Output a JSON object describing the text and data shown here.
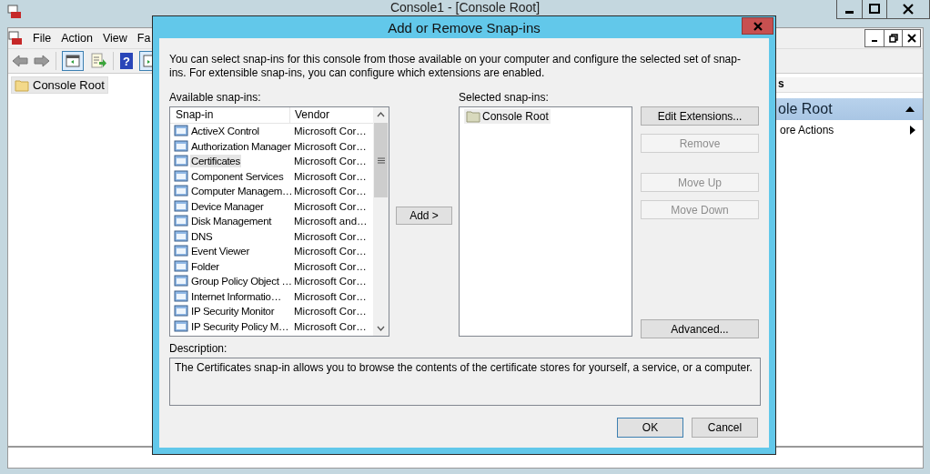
{
  "console": {
    "title": "Console1 - [Console Root]",
    "menu": [
      "File",
      "Action",
      "View",
      "Fa"
    ],
    "help_icon": "?",
    "tree": [
      {
        "label": "Console Root",
        "selected": true
      }
    ],
    "actions": {
      "header": "s",
      "section": "ole Root",
      "items": [
        "ore Actions"
      ]
    }
  },
  "dialog": {
    "title": "Add or Remove Snap-ins",
    "intro": "You can select snap-ins for this console from those available on your computer and configure the selected set of snap-ins. For extensible snap-ins, you can configure which extensions are enabled.",
    "available_label": "Available snap-ins:",
    "columns": [
      "Snap-in",
      "Vendor"
    ],
    "snapins": [
      {
        "name": "ActiveX Control",
        "vendor": "Microsoft Cor…",
        "selected": false
      },
      {
        "name": "Authorization Manager",
        "vendor": "Microsoft Cor…",
        "selected": false
      },
      {
        "name": "Certificates",
        "vendor": "Microsoft Cor…",
        "selected": true
      },
      {
        "name": "Component Services",
        "vendor": "Microsoft Cor…",
        "selected": false
      },
      {
        "name": "Computer Managem…",
        "vendor": "Microsoft Cor…",
        "selected": false
      },
      {
        "name": "Device Manager",
        "vendor": "Microsoft Cor…",
        "selected": false
      },
      {
        "name": "Disk Management",
        "vendor": "Microsoft and…",
        "selected": false
      },
      {
        "name": "DNS",
        "vendor": "Microsoft Cor…",
        "selected": false
      },
      {
        "name": "Event Viewer",
        "vendor": "Microsoft Cor…",
        "selected": false
      },
      {
        "name": "Folder",
        "vendor": "Microsoft Cor…",
        "selected": false
      },
      {
        "name": "Group Policy Object …",
        "vendor": "Microsoft Cor…",
        "selected": false
      },
      {
        "name": "Internet Informatio…",
        "vendor": "Microsoft Cor…",
        "selected": false
      },
      {
        "name": "IP Security Monitor",
        "vendor": "Microsoft Cor…",
        "selected": false
      },
      {
        "name": "IP Security Policy M…",
        "vendor": "Microsoft Cor…",
        "selected": false
      }
    ],
    "add_button": "Add >",
    "selected_label": "Selected snap-ins:",
    "selected_snapins": [
      {
        "label": "Console Root",
        "selected": true
      }
    ],
    "side_buttons": [
      {
        "label": "Edit Extensions...",
        "disabled": false
      },
      {
        "label": "Remove",
        "disabled": true
      },
      {
        "label": "Move Up",
        "disabled": true
      },
      {
        "label": "Move Down",
        "disabled": true
      }
    ],
    "advanced_button": "Advanced...",
    "description_label": "Description:",
    "description": "The Certificates snap-in allows you to browse the contents of the certificate stores for yourself, a service, or a computer.",
    "buttons": [
      {
        "label": "OK",
        "default": true
      },
      {
        "label": "Cancel",
        "default": false
      }
    ]
  }
}
